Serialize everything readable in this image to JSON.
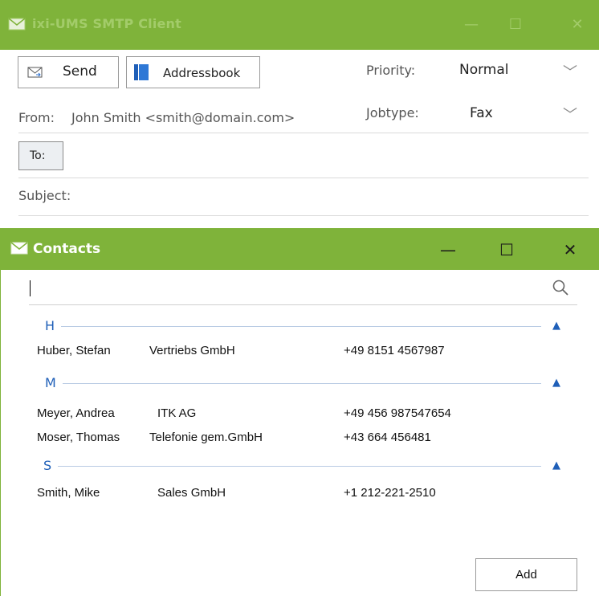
{
  "smtp_window": {
    "title": "ixi-UMS SMTP Client",
    "send_label": "Send",
    "addressbook_label": "Addressbook",
    "priority_label": "Priority:",
    "priority_value": "Normal",
    "from_label": "From:",
    "from_value": "John Smith <smith@domain.com>",
    "jobtype_label": "Jobtype:",
    "jobtype_value": "Fax",
    "to_label": "To:",
    "subject_label": "Subject:"
  },
  "contacts_window": {
    "title": "Contacts",
    "search_value": "",
    "groups": [
      {
        "letter": "H",
        "rows": [
          {
            "name": "Huber, Stefan",
            "company": "Vertriebs GmbH",
            "phone": "+49 8151 4567987"
          }
        ]
      },
      {
        "letter": "M",
        "rows": [
          {
            "name": "Meyer, Andrea",
            "company": "ITK AG",
            "phone": "+49 456 987547654"
          },
          {
            "name": "Moser, Thomas",
            "company": "Telefonie gem.GmbH",
            "phone": "+43 664 456481"
          }
        ]
      },
      {
        "letter": "S",
        "rows": [
          {
            "name": "Smith, Mike",
            "company": "Sales GmbH",
            "phone": "+1 212-221-2510"
          }
        ]
      }
    ],
    "add_label": "Add"
  },
  "colors": {
    "titlebar": "#7fb33a",
    "group_accent": "#1f5fb8"
  },
  "icons": [
    "mail-icon",
    "send-icon",
    "book-icon",
    "chevron-down-icon",
    "minimize-icon",
    "maximize-icon",
    "close-icon",
    "search-icon",
    "collapse-caret-icon"
  ]
}
